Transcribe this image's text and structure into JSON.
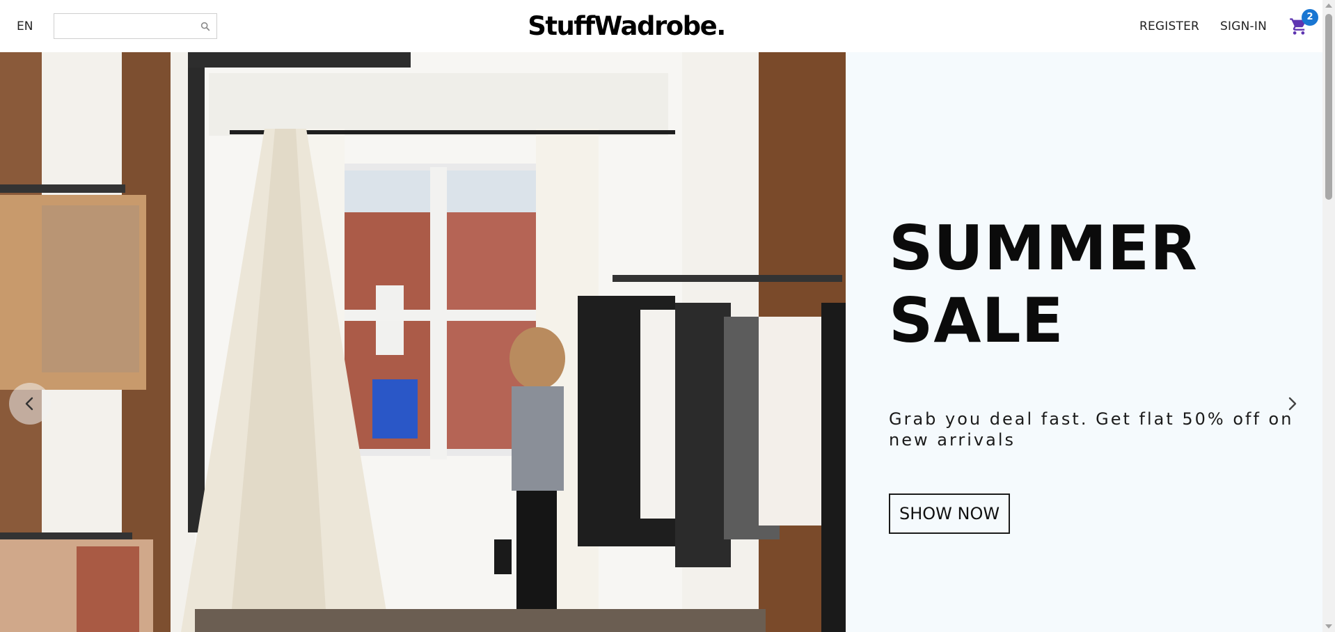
{
  "navbar": {
    "language": "EN",
    "search": {
      "value": "",
      "placeholder": "",
      "icon": "search-icon"
    },
    "logo": "StuffWadrobe.",
    "links": {
      "register": "REGISTER",
      "signin": "SIGN-IN"
    },
    "cart": {
      "icon": "cart-icon",
      "count": "2",
      "icon_color": "#5e35b1",
      "badge_color": "#1976d2"
    }
  },
  "slider": {
    "title": "SUMMER SALE",
    "description": "Grab you deal fast. Get flat 50% off on new arrivals",
    "button": "SHOW NOW",
    "background_color": "#f5fafd",
    "image": "photo of a woman browsing clothing racks in a boutique with a teepee",
    "arrows": {
      "left": "chevron-left-icon",
      "right": "chevron-right-icon"
    }
  }
}
